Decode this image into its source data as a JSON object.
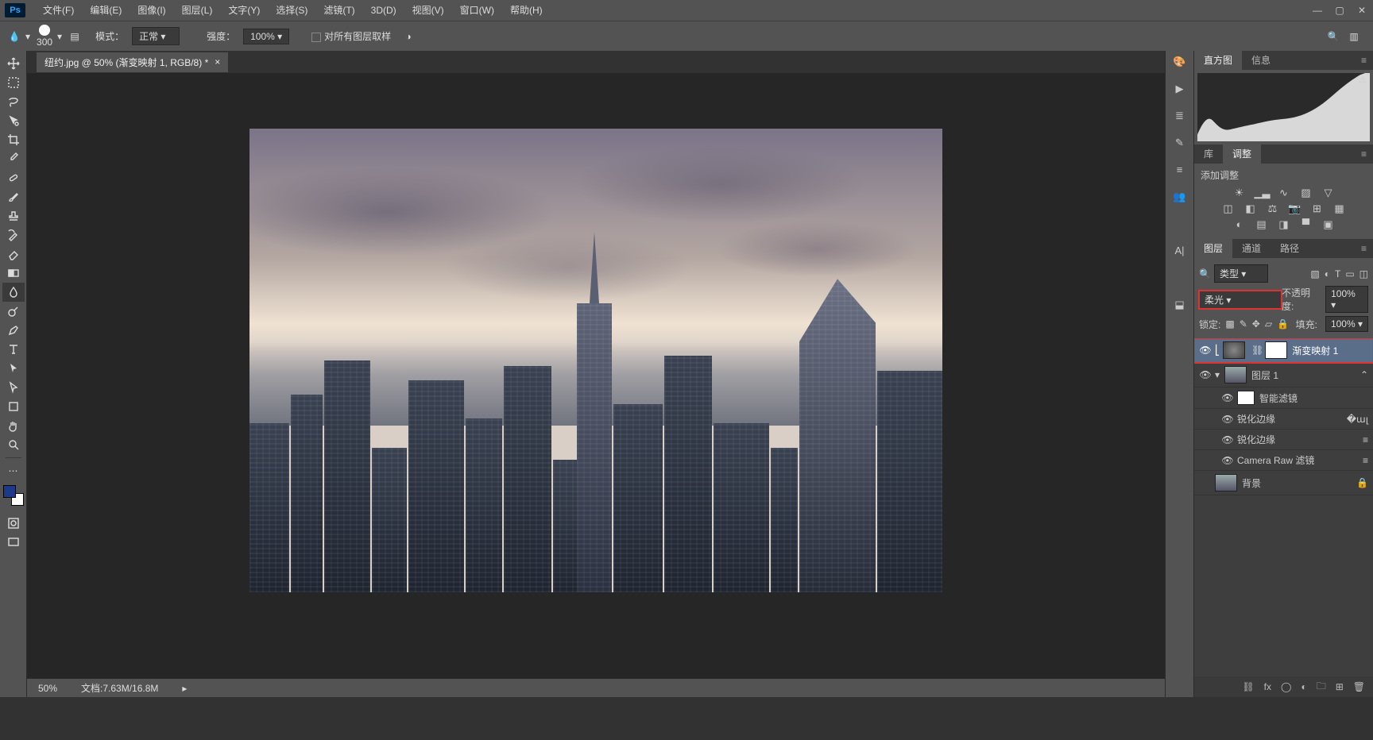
{
  "menu": {
    "items": [
      "文件(F)",
      "编辑(E)",
      "图像(I)",
      "图层(L)",
      "文字(Y)",
      "选择(S)",
      "滤镜(T)",
      "3D(D)",
      "视图(V)",
      "窗口(W)",
      "帮助(H)"
    ]
  },
  "options": {
    "brush_size": "300",
    "mode_label": "模式：",
    "mode_value": "正常",
    "strength_label": "强度：",
    "strength_value": "100%",
    "sample_all_label": "对所有图层取样"
  },
  "document": {
    "tab_title": "纽约.jpg @ 50% (渐变映射 1, RGB/8) *"
  },
  "status": {
    "zoom": "50%",
    "docinfo": "文档:7.63M/16.8M"
  },
  "panels": {
    "histogram_tab": "直方图",
    "info_tab": "信息",
    "lib_tab": "库",
    "adjust_tab": "调整",
    "add_adjust": "添加调整",
    "layers_tab": "图层",
    "channels_tab": "通道",
    "paths_tab": "路径",
    "filter_label": "类型",
    "blend_mode": "柔光",
    "opacity_label": "不透明度:",
    "opacity_value": "100%",
    "lock_label": "锁定:",
    "fill_label": "填充:",
    "fill_value": "100%",
    "layers": [
      {
        "name": "渐变映射 1",
        "kind": "adj",
        "selected": true
      },
      {
        "name": "图层 1",
        "kind": "smart"
      },
      {
        "name": "智能滤镜",
        "kind": "label"
      },
      {
        "name": "锐化边缘",
        "kind": "filter"
      },
      {
        "name": "锐化边缘",
        "kind": "filter"
      },
      {
        "name": "Camera Raw 滤镜",
        "kind": "filter"
      },
      {
        "name": "背景",
        "kind": "bg",
        "locked": true
      }
    ]
  },
  "tools": [
    "move",
    "marquee",
    "lasso",
    "magic-wand",
    "crop",
    "eyedropper",
    "healing",
    "brush",
    "stamp",
    "history-brush",
    "eraser",
    "gradient",
    "blur",
    "dodge",
    "pen",
    "type",
    "path",
    "direct",
    "shape",
    "hand",
    "zoom"
  ]
}
